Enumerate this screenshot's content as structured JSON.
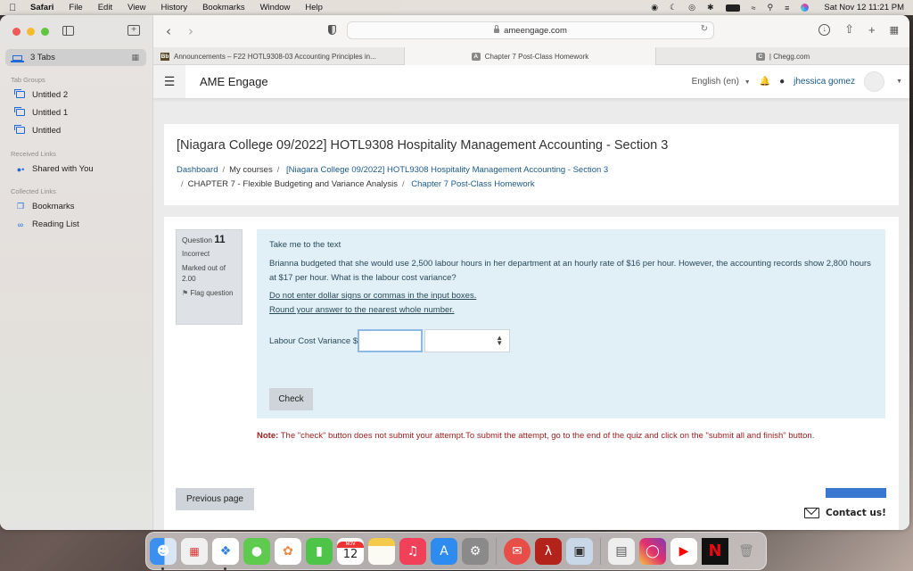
{
  "menubar": {
    "app_name": "Safari",
    "items": [
      "File",
      "Edit",
      "View",
      "History",
      "Bookmarks",
      "Window",
      "Help"
    ],
    "clock": "Sat Nov 12  11:21 PM"
  },
  "sidebar": {
    "tabs_label": "3 Tabs",
    "sections": {
      "tab_groups": "Tab Groups",
      "received_links": "Received Links",
      "collected_links": "Collected Links"
    },
    "tab_groups": [
      {
        "label": "Untitled 2"
      },
      {
        "label": "Untitled 1"
      },
      {
        "label": "Untitled"
      }
    ],
    "shared_with_you": "Shared with You",
    "bookmarks": "Bookmarks",
    "reading_list": "Reading List"
  },
  "toolbar": {
    "url": "ameengage.com"
  },
  "tabs": [
    {
      "favicon": "Bb",
      "label": "Announcements – F22 HOTL9308-03 Accounting Principles in..."
    },
    {
      "favicon": "A",
      "label": "Chapter 7 Post-Class Homework"
    },
    {
      "favicon": "C",
      "label": "| Chegg.com"
    }
  ],
  "navbar": {
    "site_name": "AME Engage",
    "language": "English (en)",
    "username": "jhessica gomez"
  },
  "header": {
    "course_title": "[Niagara College 09/2022] HOTL9308 Hospitality Management Accounting - Section 3",
    "breadcrumb": [
      {
        "label": "Dashboard",
        "link": true
      },
      {
        "label": "My courses",
        "link": false
      },
      {
        "label": "[Niagara College 09/2022] HOTL9308 Hospitality Management Accounting - Section 3",
        "link": true
      },
      {
        "label": "CHAPTER 7 - Flexible Budgeting and Variance Analysis",
        "link": false
      },
      {
        "label": "Chapter 7 Post-Class Homework",
        "link": true
      }
    ]
  },
  "question": {
    "label": "Question",
    "number": "11",
    "status": "Incorrect",
    "marked_out_of": "Marked out of 2.00",
    "flag_label": "Flag question",
    "take_me_link": "Take me to the text",
    "text": "Brianna budgeted that she would use 2,500 labour hours in her department at an hourly rate of $16 per hour. However, the accounting records show 2,800 hours at $17 per hour. What is the labour cost variance?",
    "instruction_1": "Do not enter dollar signs or commas in the input boxes.",
    "instruction_2": "Round your answer to the nearest whole number.",
    "answer_label": "Labour Cost Variance $",
    "answer_value": "",
    "select_value": "",
    "check_label": "Check"
  },
  "note": {
    "label": "Note:",
    "text": " The \"check\" button does not submit your attempt.To submit the attempt, go to the end of the quiz and click on the \"submit all and finish\" button."
  },
  "footer": {
    "previous_label": "Previous page",
    "next_label": "",
    "contact_label": "Contact us!"
  },
  "dock": {
    "calendar_month": "NOV",
    "calendar_day": "12",
    "apps": [
      "Finder",
      "Launchpad",
      "Safari",
      "Messages",
      "Photos",
      "FaceTime",
      "Calendar",
      "Notes",
      "Music",
      "App Store",
      "System Preferences",
      "Mail",
      "Acrobat",
      "Preview",
      "Screenshot",
      "Instagram",
      "YouTube",
      "Netflix",
      "Trash"
    ]
  },
  "colors": {
    "link": "#1a5a8a",
    "question_bg": "#e1eff7",
    "note_text": "#a02020",
    "accent_blue": "#3a77d0"
  }
}
